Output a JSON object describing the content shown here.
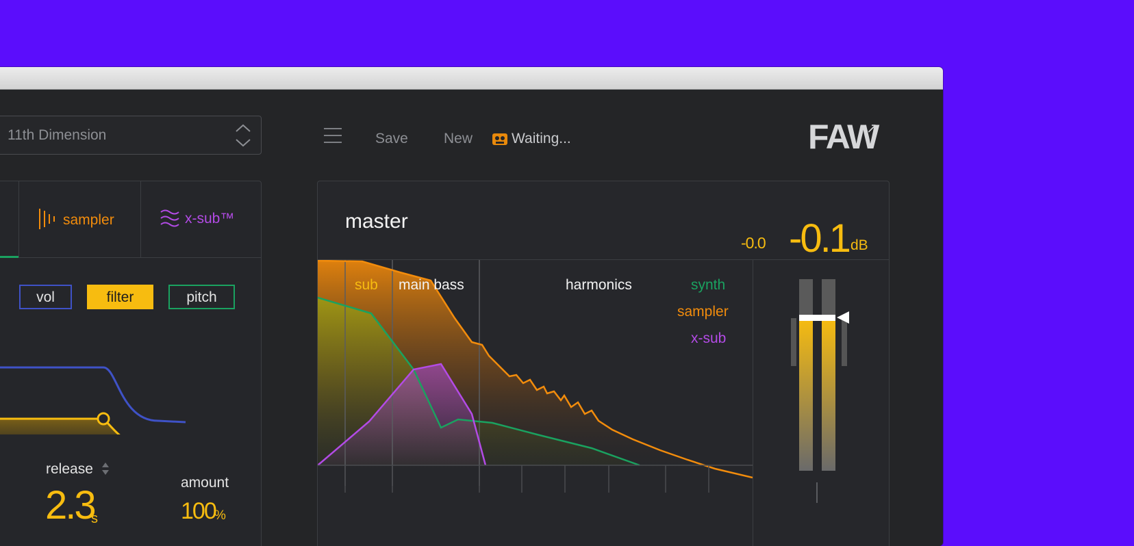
{
  "preset": {
    "name": "11th Dimension"
  },
  "toolbar": {
    "save_label": "Save",
    "new_label": "New",
    "status": "Waiting..."
  },
  "logo": {
    "text": "FAW",
    "link_icon": "external-arrow-icon"
  },
  "left_panel": {
    "tabs": [
      {
        "label": "sampler",
        "icon": "sampler-bars-icon",
        "color": "#f28c0c"
      },
      {
        "label": "x-sub™",
        "icon": "x-sub-waves-icon",
        "color": "#b34be6"
      }
    ],
    "mod_buttons": [
      {
        "label": "vol",
        "color": "#3f52c7"
      },
      {
        "label": "filter",
        "color": "#f7bc10",
        "selected": true
      },
      {
        "label": "pitch",
        "color": "#1aa260"
      }
    ],
    "release": {
      "label": "release",
      "value": "2.3",
      "unit": "s"
    },
    "amount": {
      "label": "amount",
      "value": "100",
      "unit": "%"
    }
  },
  "master": {
    "title": "master",
    "peak_hold": "-0.0",
    "level": "-0.1",
    "unit": "dB",
    "bands": [
      "sub",
      "main bass",
      "harmonics"
    ],
    "legend": [
      {
        "label": "synth",
        "color": "#1aa260"
      },
      {
        "label": "sampler",
        "color": "#f28c0c"
      },
      {
        "label": "x-sub",
        "color": "#b34be6"
      }
    ],
    "meter": {
      "left_level": 0.7,
      "right_level": 0.7,
      "fader": 0.8
    }
  },
  "colors": {
    "background": "#5b0dfc",
    "accent_yellow": "#f7bc10",
    "panel": "#242527"
  }
}
